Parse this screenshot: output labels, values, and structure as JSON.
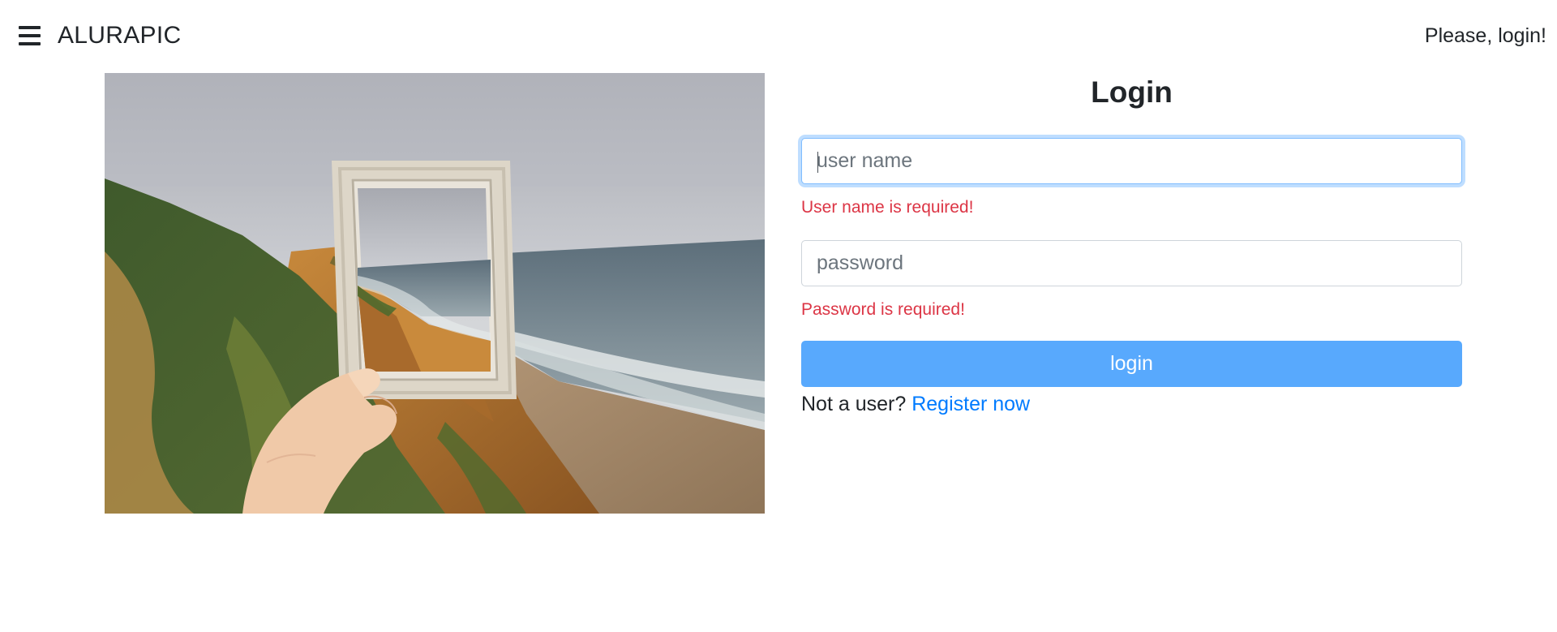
{
  "navbar": {
    "menu_icon": "hamburger-menu-icon",
    "brand": "ALURAPIC",
    "greeting": "Please, login!"
  },
  "hero_image": {
    "description_icon": "photo-hand-holding-frame-over-coastline"
  },
  "login_form": {
    "title": "Login",
    "username": {
      "value": "",
      "placeholder": "user name",
      "error": "User name is required!"
    },
    "password": {
      "value": "",
      "placeholder": "password",
      "error": "Password is required!"
    },
    "submit_label": "login",
    "register_prompt": "Not a user?",
    "register_link": "Register now"
  },
  "colors": {
    "error": "#dc3545",
    "button_bg": "#58a9fd",
    "link": "#007bff",
    "focus_border": "#80bdff"
  }
}
